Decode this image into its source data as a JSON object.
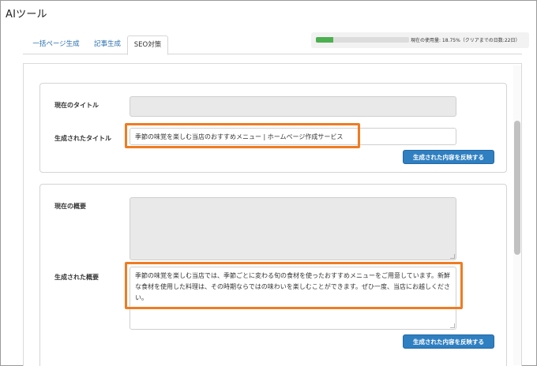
{
  "app": {
    "title": "AIツール"
  },
  "tabs": [
    {
      "label": "一括ページ生成",
      "active": false
    },
    {
      "label": "記事生成",
      "active": false
    },
    {
      "label": "SEO対策",
      "active": true
    }
  ],
  "usage": {
    "text": "現在の使用量: 18.75%（クリアまでの日数:22日）",
    "percent": 18.75,
    "bar_color": "#4caf50"
  },
  "title_section": {
    "current_label": "現在のタイトル",
    "current_value": "",
    "generated_label": "生成されたタイトル",
    "generated_value": "季節の味覚を楽しむ当店のおすすめメニュー | ホームページ作成サービス",
    "apply_button": "生成された内容を反映する"
  },
  "summary_section": {
    "current_label": "現在の概要",
    "current_value": "",
    "generated_label": "生成された概要",
    "generated_value": "季節の味覚を楽しむ当店では、季節ごとに変わる旬の食材を使ったおすすめメニューをご用意しています。新鮮な食材を使用した料理は、その時期ならではの味わいを楽しむことができます。ぜひ一度、当店にお越しください。",
    "apply_button": "生成された内容を反映する"
  },
  "colors": {
    "accent": "#2f7fc1",
    "highlight": "#f07b22",
    "tab_link": "#2a6fb0"
  }
}
